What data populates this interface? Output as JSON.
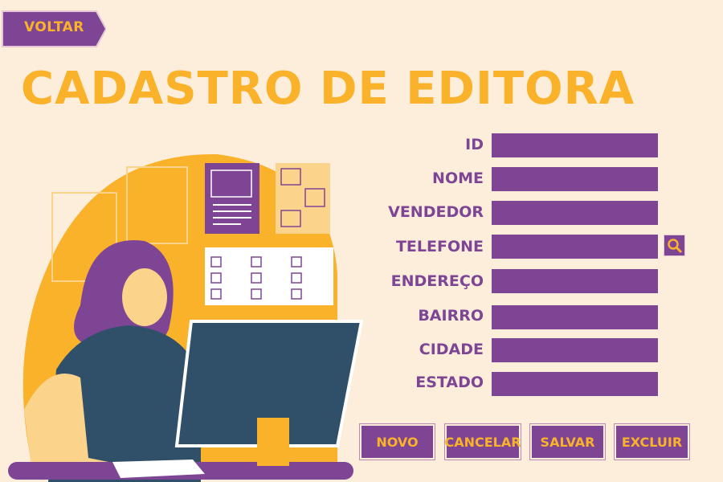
{
  "back_button": {
    "label": "VOLTAR",
    "accesskey": "V"
  },
  "page_title": "CADASTRO DE EDITORA",
  "form": {
    "fields": [
      {
        "label": "ID",
        "value": ""
      },
      {
        "label": "NOME",
        "value": ""
      },
      {
        "label": "VENDEDOR",
        "value": ""
      },
      {
        "label": "TELEFONE",
        "value": ""
      },
      {
        "label": "ENDEREÇO",
        "value": ""
      },
      {
        "label": "BAIRRO",
        "value": ""
      },
      {
        "label": "CIDADE",
        "value": ""
      },
      {
        "label": "ESTADO",
        "value": ""
      }
    ],
    "search_icon": "magnifier-icon"
  },
  "actions": {
    "novo": "NOVO",
    "cancelar": "CANCELAR",
    "salvar": "SALVAR",
    "excluir": "EXCLUIR"
  },
  "colors": {
    "background": "#fdeedb",
    "purple": "#7e4594",
    "yellow": "#f9b22a",
    "dark_teal": "#2f5068"
  }
}
